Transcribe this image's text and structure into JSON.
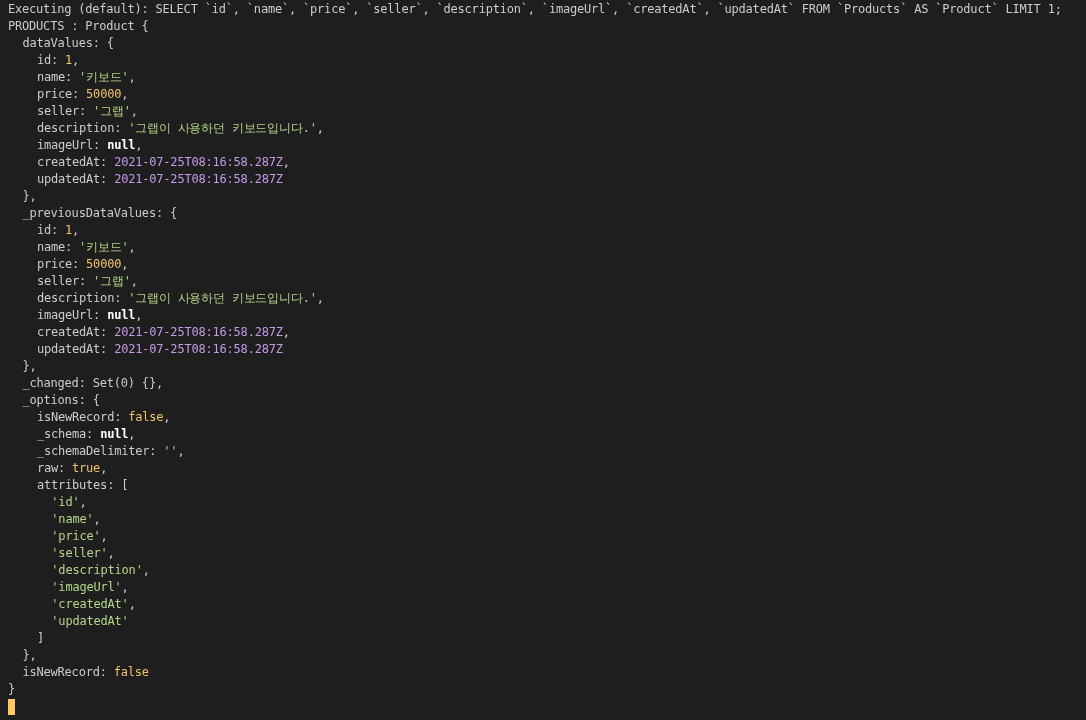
{
  "terminal": {
    "lines": [
      {
        "parts": [
          {
            "kind": "plain",
            "text": "Executing (default): SELECT `id`, `name`, `price`, `seller`, `description`, `imageUrl`, `createdAt`, `updatedAt` FROM `Products` AS `Product` LIMIT 1;"
          }
        ]
      },
      {
        "parts": [
          {
            "kind": "plain",
            "text": "PRODUCTS : Product {"
          }
        ],
        "children": [
          {
            "parts": [
              {
                "kind": "plain",
                "text": "dataValues: {"
              }
            ],
            "children": [
              {
                "parts": [
                  {
                    "kind": "plain",
                    "text": "id: "
                  },
                  {
                    "kind": "number",
                    "text": "1"
                  },
                  {
                    "kind": "plain",
                    "text": ","
                  }
                ]
              },
              {
                "parts": [
                  {
                    "kind": "plain",
                    "text": "name: "
                  },
                  {
                    "kind": "string",
                    "text": "'키보드'"
                  },
                  {
                    "kind": "plain",
                    "text": ","
                  }
                ]
              },
              {
                "parts": [
                  {
                    "kind": "plain",
                    "text": "price: "
                  },
                  {
                    "kind": "number",
                    "text": "50000"
                  },
                  {
                    "kind": "plain",
                    "text": ","
                  }
                ]
              },
              {
                "parts": [
                  {
                    "kind": "plain",
                    "text": "seller: "
                  },
                  {
                    "kind": "string",
                    "text": "'그랩'"
                  },
                  {
                    "kind": "plain",
                    "text": ","
                  }
                ]
              },
              {
                "parts": [
                  {
                    "kind": "plain",
                    "text": "description: "
                  },
                  {
                    "kind": "string",
                    "text": "'그랩이 사용하던 키보드입니다.'"
                  },
                  {
                    "kind": "plain",
                    "text": ","
                  }
                ]
              },
              {
                "parts": [
                  {
                    "kind": "plain",
                    "text": "imageUrl: "
                  },
                  {
                    "kind": "null",
                    "text": "null"
                  },
                  {
                    "kind": "plain",
                    "text": ","
                  }
                ]
              },
              {
                "parts": [
                  {
                    "kind": "plain",
                    "text": "createdAt: "
                  },
                  {
                    "kind": "date",
                    "text": "2021-07-25T08:16:58.287Z"
                  },
                  {
                    "kind": "plain",
                    "text": ","
                  }
                ]
              },
              {
                "parts": [
                  {
                    "kind": "plain",
                    "text": "updatedAt: "
                  },
                  {
                    "kind": "date",
                    "text": "2021-07-25T08:16:58.287Z"
                  }
                ]
              }
            ]
          },
          {
            "parts": [
              {
                "kind": "plain",
                "text": "},"
              }
            ]
          },
          {
            "parts": [
              {
                "kind": "plain",
                "text": "_previousDataValues: {"
              }
            ],
            "children": [
              {
                "parts": [
                  {
                    "kind": "plain",
                    "text": "id: "
                  },
                  {
                    "kind": "number",
                    "text": "1"
                  },
                  {
                    "kind": "plain",
                    "text": ","
                  }
                ]
              },
              {
                "parts": [
                  {
                    "kind": "plain",
                    "text": "name: "
                  },
                  {
                    "kind": "string",
                    "text": "'키보드'"
                  },
                  {
                    "kind": "plain",
                    "text": ","
                  }
                ]
              },
              {
                "parts": [
                  {
                    "kind": "plain",
                    "text": "price: "
                  },
                  {
                    "kind": "number",
                    "text": "50000"
                  },
                  {
                    "kind": "plain",
                    "text": ","
                  }
                ]
              },
              {
                "parts": [
                  {
                    "kind": "plain",
                    "text": "seller: "
                  },
                  {
                    "kind": "string",
                    "text": "'그랩'"
                  },
                  {
                    "kind": "plain",
                    "text": ","
                  }
                ]
              },
              {
                "parts": [
                  {
                    "kind": "plain",
                    "text": "description: "
                  },
                  {
                    "kind": "string",
                    "text": "'그랩이 사용하던 키보드입니다.'"
                  },
                  {
                    "kind": "plain",
                    "text": ","
                  }
                ]
              },
              {
                "parts": [
                  {
                    "kind": "plain",
                    "text": "imageUrl: "
                  },
                  {
                    "kind": "null",
                    "text": "null"
                  },
                  {
                    "kind": "plain",
                    "text": ","
                  }
                ]
              },
              {
                "parts": [
                  {
                    "kind": "plain",
                    "text": "createdAt: "
                  },
                  {
                    "kind": "date",
                    "text": "2021-07-25T08:16:58.287Z"
                  },
                  {
                    "kind": "plain",
                    "text": ","
                  }
                ]
              },
              {
                "parts": [
                  {
                    "kind": "plain",
                    "text": "updatedAt: "
                  },
                  {
                    "kind": "date",
                    "text": "2021-07-25T08:16:58.287Z"
                  }
                ]
              }
            ]
          },
          {
            "parts": [
              {
                "kind": "plain",
                "text": "},"
              }
            ]
          },
          {
            "parts": [
              {
                "kind": "plain",
                "text": "_changed: Set(0) {},"
              }
            ]
          },
          {
            "parts": [
              {
                "kind": "plain",
                "text": "_options: {"
              }
            ],
            "children": [
              {
                "parts": [
                  {
                    "kind": "plain",
                    "text": "isNewRecord: "
                  },
                  {
                    "kind": "number",
                    "text": "false"
                  },
                  {
                    "kind": "plain",
                    "text": ","
                  }
                ]
              },
              {
                "parts": [
                  {
                    "kind": "plain",
                    "text": "_schema: "
                  },
                  {
                    "kind": "null",
                    "text": "null"
                  },
                  {
                    "kind": "plain",
                    "text": ","
                  }
                ]
              },
              {
                "parts": [
                  {
                    "kind": "plain",
                    "text": "_schemaDelimiter: "
                  },
                  {
                    "kind": "string",
                    "text": "''"
                  },
                  {
                    "kind": "plain",
                    "text": ","
                  }
                ]
              },
              {
                "parts": [
                  {
                    "kind": "plain",
                    "text": "raw: "
                  },
                  {
                    "kind": "number",
                    "text": "true"
                  },
                  {
                    "kind": "plain",
                    "text": ","
                  }
                ]
              },
              {
                "parts": [
                  {
                    "kind": "plain",
                    "text": "attributes: ["
                  }
                ],
                "children": [
                  {
                    "parts": [
                      {
                        "kind": "string",
                        "text": "'id'"
                      },
                      {
                        "kind": "plain",
                        "text": ","
                      }
                    ]
                  },
                  {
                    "parts": [
                      {
                        "kind": "string",
                        "text": "'name'"
                      },
                      {
                        "kind": "plain",
                        "text": ","
                      }
                    ]
                  },
                  {
                    "parts": [
                      {
                        "kind": "string",
                        "text": "'price'"
                      },
                      {
                        "kind": "plain",
                        "text": ","
                      }
                    ]
                  },
                  {
                    "parts": [
                      {
                        "kind": "string",
                        "text": "'seller'"
                      },
                      {
                        "kind": "plain",
                        "text": ","
                      }
                    ]
                  },
                  {
                    "parts": [
                      {
                        "kind": "string",
                        "text": "'description'"
                      },
                      {
                        "kind": "plain",
                        "text": ","
                      }
                    ]
                  },
                  {
                    "parts": [
                      {
                        "kind": "string",
                        "text": "'imageUrl'"
                      },
                      {
                        "kind": "plain",
                        "text": ","
                      }
                    ]
                  },
                  {
                    "parts": [
                      {
                        "kind": "string",
                        "text": "'createdAt'"
                      },
                      {
                        "kind": "plain",
                        "text": ","
                      }
                    ]
                  },
                  {
                    "parts": [
                      {
                        "kind": "string",
                        "text": "'updatedAt'"
                      }
                    ]
                  }
                ]
              },
              {
                "parts": [
                  {
                    "kind": "plain",
                    "text": "]"
                  }
                ]
              }
            ]
          },
          {
            "parts": [
              {
                "kind": "plain",
                "text": "},"
              }
            ]
          },
          {
            "parts": [
              {
                "kind": "plain",
                "text": "isNewRecord: "
              },
              {
                "kind": "number",
                "text": "false"
              }
            ]
          }
        ]
      },
      {
        "parts": [
          {
            "kind": "plain",
            "text": "}"
          }
        ]
      }
    ]
  }
}
